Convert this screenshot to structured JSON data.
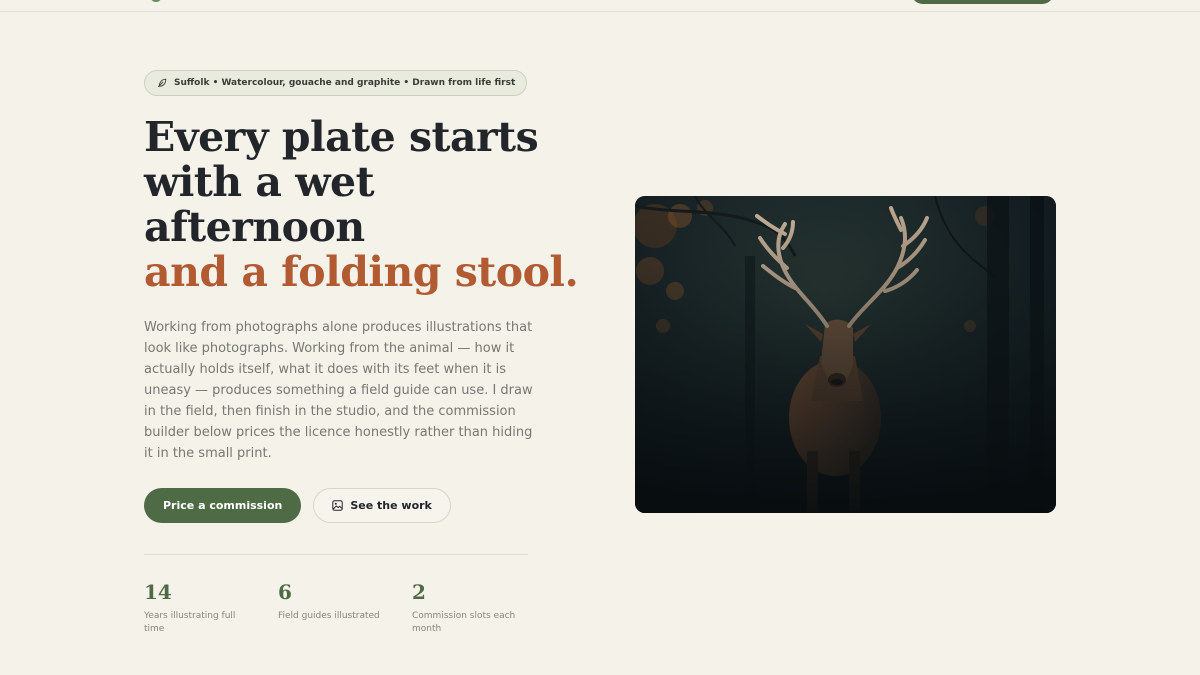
{
  "hero": {
    "tagline": "Suffolk • Watercolour, gouache and graphite • Drawn from life first",
    "headline_lines": [
      "Every plate starts",
      "with a wet",
      "afternoon"
    ],
    "headline_accent": "and a folding stool.",
    "intro": "Working from photographs alone produces illustrations that look like photographs. Working from the animal — how it actually holds itself, what it does with its feet when it is uneasy — produces something a field guide can use. I draw in the field, then finish in the studio, and the commission builder below prices the licence honestly rather than hiding it in the small print.",
    "primary_cta": "Price a commission",
    "secondary_cta": "See the work"
  },
  "stats": [
    {
      "value": "14",
      "label": "Years illustrating full time"
    },
    {
      "value": "6",
      "label": "Field guides illustrated"
    },
    {
      "value": "2",
      "label": "Commission slots each month"
    }
  ],
  "icons": {
    "tagline": "feather-icon",
    "secondary_cta": "image-icon"
  },
  "colors": {
    "background": "#f5f2ea",
    "brand_green": "#4f6b46",
    "accent_rust": "#b25a32",
    "text_dark": "#22252a",
    "text_muted": "#767873"
  }
}
